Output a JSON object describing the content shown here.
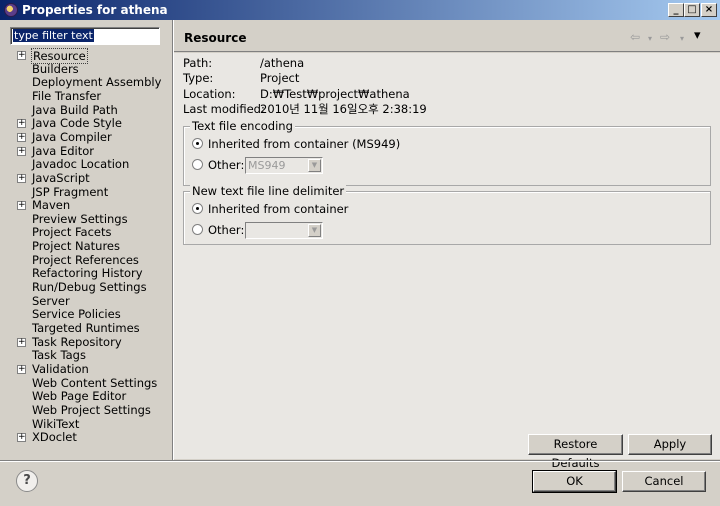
{
  "window": {
    "title": "Properties for athena",
    "minimize": "_",
    "maximize": "□",
    "close": "×"
  },
  "filter": {
    "text": "type filter text"
  },
  "tree": [
    {
      "label": "Resource",
      "expandable": true,
      "selected": true
    },
    {
      "label": "Builders",
      "expandable": false
    },
    {
      "label": "Deployment Assembly",
      "expandable": false
    },
    {
      "label": "File Transfer",
      "expandable": false
    },
    {
      "label": "Java Build Path",
      "expandable": false
    },
    {
      "label": "Java Code Style",
      "expandable": true
    },
    {
      "label": "Java Compiler",
      "expandable": true
    },
    {
      "label": "Java Editor",
      "expandable": true
    },
    {
      "label": "Javadoc Location",
      "expandable": false
    },
    {
      "label": "JavaScript",
      "expandable": true
    },
    {
      "label": "JSP Fragment",
      "expandable": false
    },
    {
      "label": "Maven",
      "expandable": true
    },
    {
      "label": "Preview Settings",
      "expandable": false
    },
    {
      "label": "Project Facets",
      "expandable": false
    },
    {
      "label": "Project Natures",
      "expandable": false
    },
    {
      "label": "Project References",
      "expandable": false
    },
    {
      "label": "Refactoring History",
      "expandable": false
    },
    {
      "label": "Run/Debug Settings",
      "expandable": false
    },
    {
      "label": "Server",
      "expandable": false
    },
    {
      "label": "Service Policies",
      "expandable": false
    },
    {
      "label": "Targeted Runtimes",
      "expandable": false
    },
    {
      "label": "Task Repository",
      "expandable": true
    },
    {
      "label": "Task Tags",
      "expandable": false
    },
    {
      "label": "Validation",
      "expandable": true
    },
    {
      "label": "Web Content Settings",
      "expandable": false
    },
    {
      "label": "Web Page Editor",
      "expandable": false
    },
    {
      "label": "Web Project Settings",
      "expandable": false
    },
    {
      "label": "WikiText",
      "expandable": false
    },
    {
      "label": "XDoclet",
      "expandable": true
    }
  ],
  "page": {
    "title": "Resource",
    "nav": {
      "back": "⇦",
      "back_menu": "▾",
      "forward": "⇨",
      "forward_menu": "▾",
      "view_menu": "▾"
    },
    "props": [
      {
        "label": "Path:",
        "value": "/athena"
      },
      {
        "label": "Type:",
        "value": "Project"
      },
      {
        "label": "Location:",
        "value": "D:₩Test₩project₩athena"
      },
      {
        "label": "Last modified:",
        "value": "2010년 11월 16일오후 2:38:19"
      }
    ],
    "encoding": {
      "title": "Text file encoding",
      "inherited_label": "Inherited from container (MS949)",
      "other_label": "Other:",
      "other_value": "MS949",
      "selected": "inherited"
    },
    "delimiter": {
      "title": "New text file line delimiter",
      "inherited_label": "Inherited from container",
      "other_label": "Other:",
      "other_value": "",
      "selected": "inherited"
    },
    "restore_label": "Restore Defaults",
    "apply_label": "Apply"
  },
  "footer": {
    "help": "?",
    "ok_label": "OK",
    "cancel_label": "Cancel"
  }
}
